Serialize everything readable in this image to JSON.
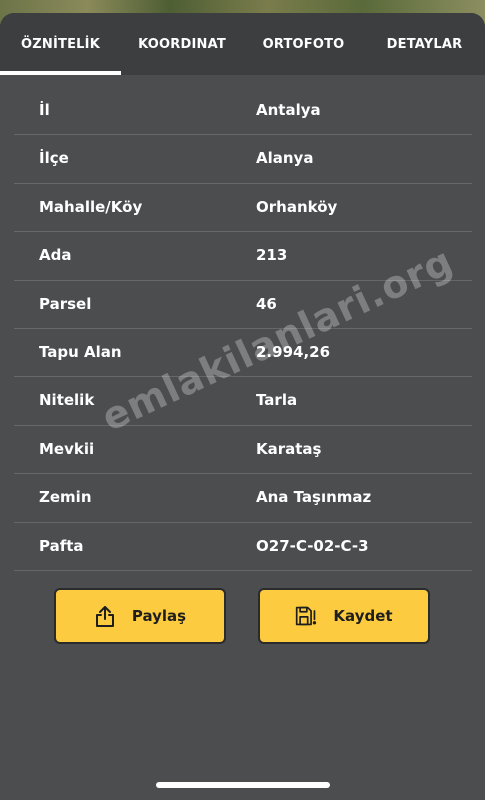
{
  "tabs": [
    {
      "label": "ÖZNİTELİK"
    },
    {
      "label": "KOORDINAT"
    },
    {
      "label": "ORTOFOTO"
    },
    {
      "label": "DETAYLAR"
    }
  ],
  "rows": [
    {
      "label": "İl",
      "value": "Antalya"
    },
    {
      "label": "İlçe",
      "value": "Alanya"
    },
    {
      "label": "Mahalle/Köy",
      "value": "Orhanköy"
    },
    {
      "label": "Ada",
      "value": "213"
    },
    {
      "label": "Parsel",
      "value": "46"
    },
    {
      "label": "Tapu Alan",
      "value": "2.994,26"
    },
    {
      "label": "Nitelik",
      "value": "Tarla"
    },
    {
      "label": "Mevkii",
      "value": "Karataş"
    },
    {
      "label": "Zemin",
      "value": "Ana Taşınmaz"
    },
    {
      "label": "Pafta",
      "value": "O27-C-02-C-3"
    }
  ],
  "actions": {
    "share_label": "Paylaş",
    "save_label": "Kaydet"
  },
  "watermark": "emlakilanlari.org",
  "icons": {
    "share": "share-icon",
    "save": "save-icon"
  },
  "colors": {
    "button_yellow": "#fccb3f",
    "panel_bg": "#4c4d4f",
    "tabbar_bg": "#3d3e40"
  }
}
